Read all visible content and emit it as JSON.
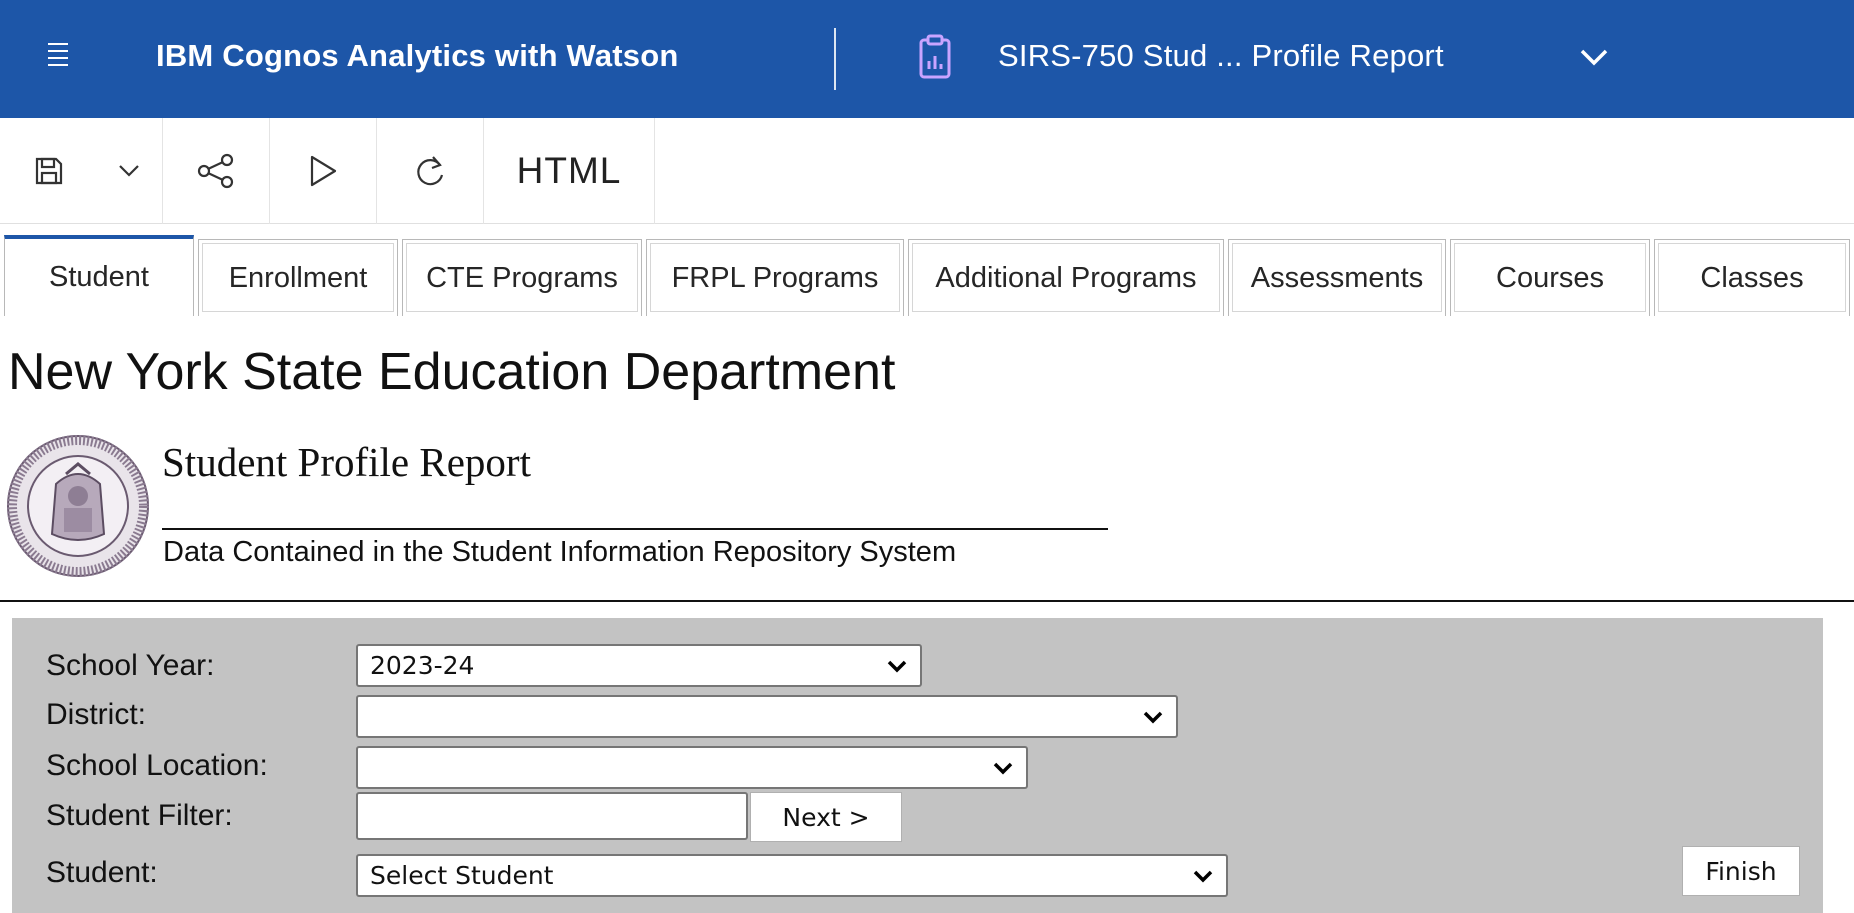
{
  "header": {
    "app_title": "IBM Cognos Analytics with Watson",
    "report_title": "SIRS-750 Stud ... Profile Report",
    "menu_icon": "hamburger-menu-icon",
    "report_icon": "report-clipboard-icon",
    "chevron_icon": "chevron-down-icon",
    "background_color": "#1d56a8"
  },
  "toolbar": {
    "save_icon": "save-icon",
    "save_menu_icon": "chevron-down-icon",
    "share_icon": "share-icon",
    "run_icon": "run-play-icon",
    "refresh_icon": "refresh-icon",
    "output_format": "HTML"
  },
  "tabs": [
    {
      "label": "Student",
      "active": true
    },
    {
      "label": "Enrollment",
      "active": false
    },
    {
      "label": "CTE Programs",
      "active": false
    },
    {
      "label": "FRPL Programs",
      "active": false
    },
    {
      "label": "Additional Programs",
      "active": false
    },
    {
      "label": "Assessments",
      "active": false
    },
    {
      "label": "Courses",
      "active": false
    },
    {
      "label": "Classes",
      "active": false
    }
  ],
  "report": {
    "organization": "New York State Education Department",
    "seal_icon": "state-seal-logo",
    "name": "Student Profile Report",
    "subtitle": "Data Contained in the Student Information Repository System"
  },
  "prompts": {
    "school_year": {
      "label": "School Year:",
      "value": "2023-24"
    },
    "district": {
      "label": "District:",
      "value": ""
    },
    "school_location": {
      "label": "School Location:",
      "value": ""
    },
    "student_filter": {
      "label": "Student Filter:",
      "value": "",
      "next_label": "Next >"
    },
    "student": {
      "label": "Student:",
      "value": "Select Student"
    },
    "finish_label": "Finish",
    "panel_color": "#c3c3c3"
  }
}
